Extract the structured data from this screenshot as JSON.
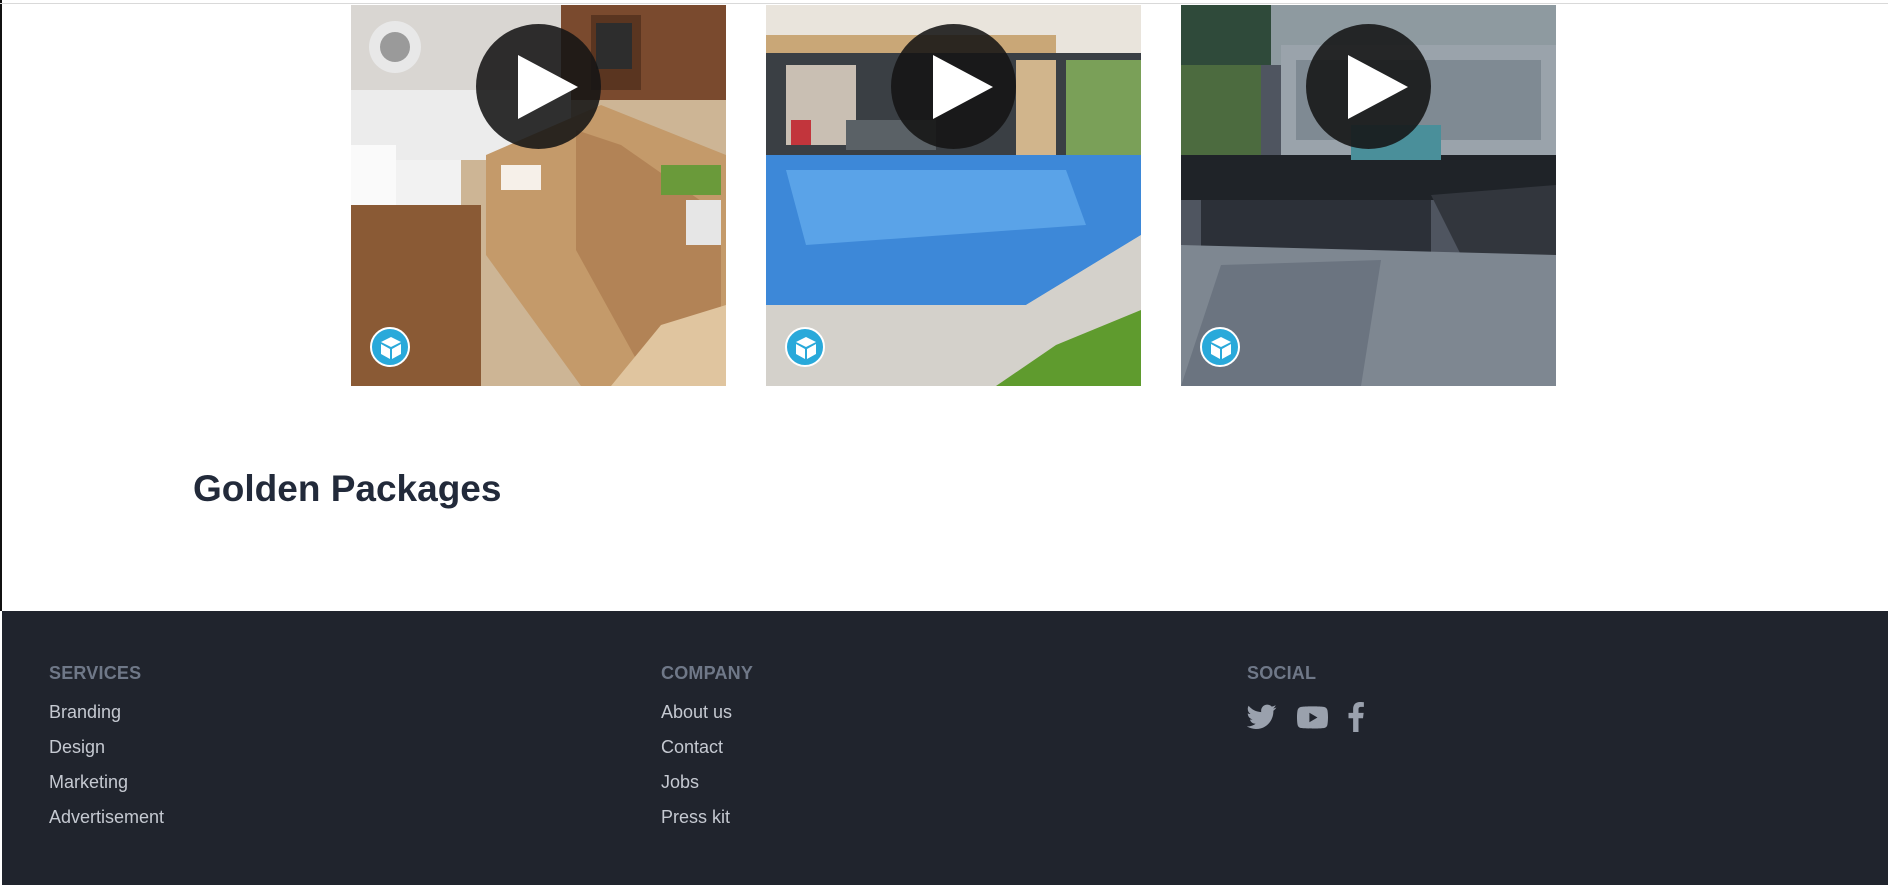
{
  "gallery": {
    "tiles": [
      {
        "alt": "interior-living-room",
        "play": "play-button",
        "badge": "3d-cube-icon"
      },
      {
        "alt": "pool-house",
        "play": "play-button",
        "badge": "3d-cube-icon"
      },
      {
        "alt": "modern-facade",
        "play": "play-button",
        "badge": "3d-cube-icon"
      }
    ]
  },
  "section": {
    "title": "Golden Packages"
  },
  "footer": {
    "services": {
      "title": "SERVICES",
      "links": [
        "Branding",
        "Design",
        "Marketing",
        "Advertisement"
      ]
    },
    "company": {
      "title": "COMPANY",
      "links": [
        "About us",
        "Contact",
        "Jobs",
        "Press kit"
      ]
    },
    "social": {
      "title": "SOCIAL",
      "icons": [
        "twitter-icon",
        "youtube-icon",
        "facebook-icon"
      ]
    }
  },
  "colors": {
    "footer_bg": "#20242d",
    "badge": "#29a9da",
    "heading": "#222a3a"
  }
}
